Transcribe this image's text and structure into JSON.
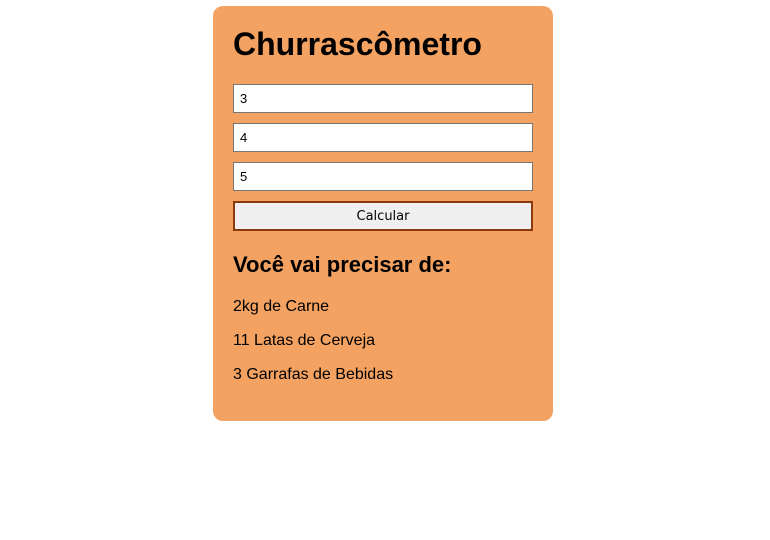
{
  "app": {
    "title": "Churrascômetro"
  },
  "inputs": [
    {
      "value": "3"
    },
    {
      "value": "4"
    },
    {
      "value": "5"
    }
  ],
  "form": {
    "submit_label": "Calcular"
  },
  "results": {
    "heading": "Você vai precisar de:",
    "items": [
      "2kg de Carne",
      "11 Latas de Cerveja",
      "3 Garrafas de Bebidas"
    ]
  },
  "colors": {
    "card_background": "#f4a261",
    "button_border": "#8b3a0f",
    "page_background": "#ffffff"
  }
}
